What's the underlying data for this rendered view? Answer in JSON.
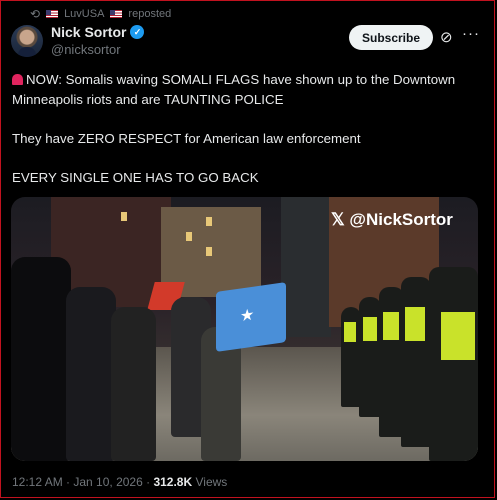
{
  "repost": {
    "icon": "repost-icon",
    "user": "LuvUSA",
    "label": "reposted"
  },
  "author": {
    "name": "Nick Sortor",
    "handle": "@nicksortor",
    "verified": true
  },
  "actions": {
    "subscribe_label": "Subscribe",
    "grok_icon": "grok-icon",
    "more_icon": "more-icon"
  },
  "tweet": {
    "line1": "NOW: Somalis waving SOMALI FLAGS have shown up to the Downtown Minneapolis riots and are TAUNTING POLICE",
    "line2": "They have ZERO RESPECT for American law enforcement",
    "line3": "EVERY SINGLE ONE HAS TO GO BACK"
  },
  "media": {
    "watermark": "𝕏 @NickSortor"
  },
  "meta": {
    "time": "12:12 AM",
    "date": "Jan 10, 2026",
    "views_count": "312.8K",
    "views_label": "Views"
  },
  "colors": {
    "accent": "#1d9bf0",
    "background": "#000000",
    "border": "#c1121f"
  }
}
